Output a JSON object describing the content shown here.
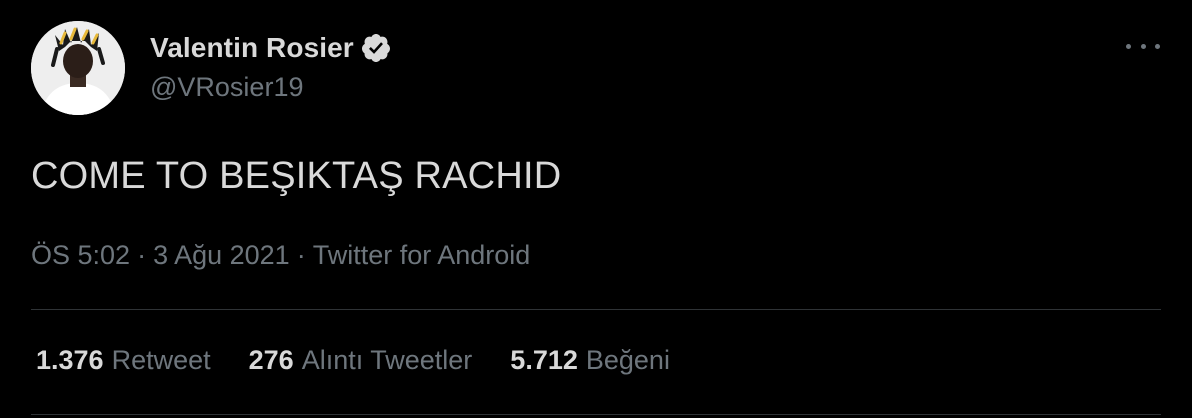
{
  "author": {
    "display_name": "Valentin Rosier",
    "handle": "@VRosier19",
    "verified": true
  },
  "icons": {
    "verified": "verified-badge-icon",
    "more": "more-options-icon"
  },
  "tweet": {
    "text": "COME TO BEŞIKTAŞ RACHID",
    "time": "ÖS 5:02",
    "date": "3 Ağu 2021",
    "source": "Twitter for Android",
    "separator": "·"
  },
  "stats": [
    {
      "count": "1.376",
      "label": "Retweet"
    },
    {
      "count": "276",
      "label": "Alıntı Tweetler"
    },
    {
      "count": "5.712",
      "label": "Beğeni"
    }
  ],
  "colors": {
    "background": "#000000",
    "primary_text": "#d9d9d9",
    "secondary_text": "#6e767d",
    "divider": "#2f3336"
  }
}
